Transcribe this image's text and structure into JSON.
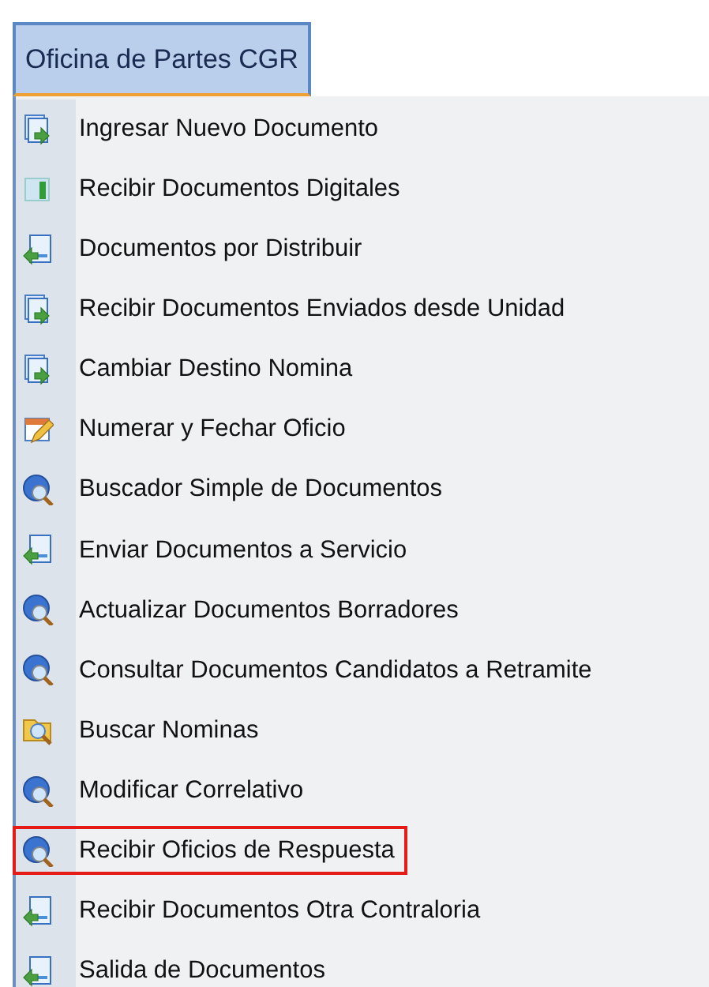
{
  "menu": {
    "title": "Oficina de Partes CGR",
    "items": [
      {
        "label": "Ingresar Nuevo Documento",
        "kind": "doc-in",
        "highlighted": false
      },
      {
        "label": "Recibir Documentos Digitales",
        "kind": "digital",
        "highlighted": false
      },
      {
        "label": "Documentos por Distribuir",
        "kind": "doc-out",
        "highlighted": false
      },
      {
        "label": "Recibir Documentos Enviados desde Unidad",
        "kind": "doc-in",
        "highlighted": false
      },
      {
        "label": "Cambiar Destino Nomina",
        "kind": "doc-in",
        "highlighted": false
      },
      {
        "label": "Numerar y Fechar Oficio",
        "kind": "calendar",
        "highlighted": false
      },
      {
        "label": "Buscador Simple de Documentos",
        "kind": "globe-search",
        "highlighted": false
      },
      {
        "label": "Enviar Documentos a Servicio",
        "kind": "doc-out",
        "highlighted": false
      },
      {
        "label": "Actualizar Documentos Borradores",
        "kind": "globe-search",
        "highlighted": false
      },
      {
        "label": "Consultar Documentos Candidatos a Retramite",
        "kind": "globe-search",
        "highlighted": false
      },
      {
        "label": "Buscar Nominas",
        "kind": "folder-search",
        "highlighted": false
      },
      {
        "label": "Modificar Correlativo",
        "kind": "globe-search",
        "highlighted": false
      },
      {
        "label": "Recibir Oficios de Respuesta",
        "kind": "globe-search",
        "highlighted": true
      },
      {
        "label": "Recibir Documentos Otra Contraloria",
        "kind": "doc-out",
        "highlighted": false
      },
      {
        "label": "Salida de Documentos",
        "kind": "doc-out",
        "highlighted": false
      }
    ]
  }
}
